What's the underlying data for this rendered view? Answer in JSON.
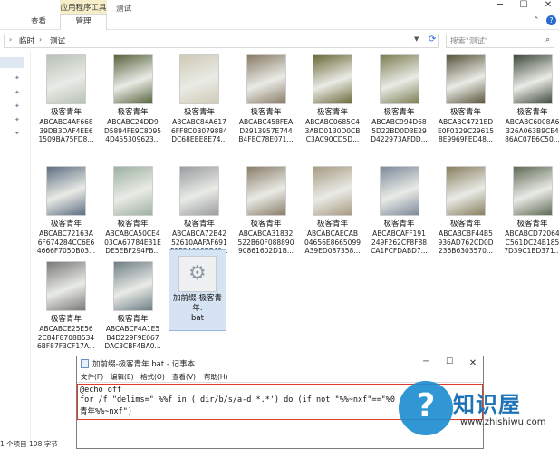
{
  "ribbon": {
    "context_group_label": "应用程序工具",
    "active_tab_label": "管理",
    "view_tab_label": "查看",
    "window_title": "测试",
    "minimize": "─",
    "maximize": "☐",
    "close": "✕",
    "collapse_glyph": "⌃"
  },
  "address": {
    "crumbs": [
      "临时",
      "测试"
    ],
    "separator": "›",
    "search_placeholder": "搜索\"测试\""
  },
  "thumbnails": [
    {
      "name": "极客青年",
      "id_lines": [
        "ABCABC4AF668",
        "39DB3DAF4EE6",
        "1509BA75FD8..."
      ],
      "color": "#b8c1b6"
    },
    {
      "name": "极客青年",
      "id_lines": [
        "ABCABC24DD9",
        "D5894FE9C8095",
        "4D455309623..."
      ],
      "color": "#58643e"
    },
    {
      "name": "极客青年",
      "id_lines": [
        "ABCABC84A617",
        "6FF8C0B079884",
        "DC68EBE8E74..."
      ],
      "color": "#cfcab5"
    },
    {
      "name": "极客青年",
      "id_lines": [
        "ABCABC458FEA",
        "D2913957E744",
        "B4FBC78E071..."
      ],
      "color": "#8a7c66"
    },
    {
      "name": "极客青年",
      "id_lines": [
        "ABCABC0685C4",
        "3ABD0130D0CB",
        "C3AC90CD5D..."
      ],
      "color": "#6d6a3a"
    },
    {
      "name": "极客青年",
      "id_lines": [
        "ABCABC994D68",
        "5D22BD0D3E29",
        "D422973AFDD..."
      ],
      "color": "#7c7f52"
    },
    {
      "name": "极客青年",
      "id_lines": [
        "ABCABC4721ED",
        "E0F0129C29615",
        "8E9969FED48..."
      ],
      "color": "#5a553c"
    },
    {
      "name": "极客青年",
      "id_lines": [
        "ABCABC6008A6",
        "326A063B9CE4",
        "86AC07E6C50..."
      ],
      "color": "#3f4a3c"
    },
    {
      "name": "极客青年",
      "id_lines": [
        "ABCABC72163A",
        "6F674284CC6E6",
        "4666F7050B03..."
      ],
      "color": "#5d6f83"
    },
    {
      "name": "极客青年",
      "id_lines": [
        "ABCABCA50CE4",
        "03CA67784E31E",
        "DE5EBF294FB..."
      ],
      "color": "#9eb1a1"
    },
    {
      "name": "极客青年",
      "id_lines": [
        "ABCABCA72B42",
        "52610AAFAF691",
        "F1E24699E740..."
      ],
      "color": "#9a9ca0"
    },
    {
      "name": "极客青年",
      "id_lines": [
        "ABCABCA31832",
        "522B60F088890",
        "90861602D1B..."
      ],
      "color": "#8b7e6a"
    },
    {
      "name": "极客青年",
      "id_lines": [
        "ABCABCAECAB",
        "04656E8665099",
        "A39ED087358..."
      ],
      "color": "#a89b83"
    },
    {
      "name": "极客青年",
      "id_lines": [
        "ABCABCAFF191",
        "249F262CF8F88",
        "CA1FCFDABD7..."
      ],
      "color": "#7d8a9a"
    },
    {
      "name": "极客青年",
      "id_lines": [
        "ABCABCBF44B5",
        "936AD762CD0D",
        "236B6303570..."
      ],
      "color": "#8a8060"
    },
    {
      "name": "极客青年",
      "id_lines": [
        "ABCABCD72064",
        "C561DC24B185",
        "7D39C1BD371..."
      ],
      "color": "#5f6a55"
    },
    {
      "name": "极客青年",
      "id_lines": [
        "ABCABCE25E56",
        "2C84F8708B534",
        "6BF87F3CF17A..."
      ],
      "color": "#7a7a78"
    },
    {
      "name": "极客青年",
      "id_lines": [
        "ABCABCF4A1E5",
        "B4D229F9E067",
        "DAC3CBF4BA0..."
      ],
      "color": "#6f7f86"
    }
  ],
  "bat_file": {
    "name_lines": [
      "加前缀-极客青年.",
      "bat"
    ],
    "icon": "gear-icon"
  },
  "notepad": {
    "title": "加前缀-极客青年.bat - 记事本",
    "minimize": "─",
    "maximize": "☐",
    "close": "✕",
    "menu": [
      "文件(F)",
      "编辑(E)",
      "格式(O)",
      "查看(V)",
      "帮助(H)"
    ],
    "code": [
      "@echo off",
      "for /f \"delims=\" %%f in ('dir/b/s/a-d *.*') do (if not \"%%~nxf\"==\"%0",
      "青年%%~nxf\")"
    ]
  },
  "status": {
    "text": "1 个项目  108 字节"
  },
  "watermark": {
    "symbol": "?",
    "cn": "知识屋",
    "en": "www.zhishiwu.com"
  },
  "colors": {
    "highlight_box": "#e03a2a",
    "selection_bg": "#d6e3f3",
    "watermark_blue": "#1e8ed0"
  }
}
